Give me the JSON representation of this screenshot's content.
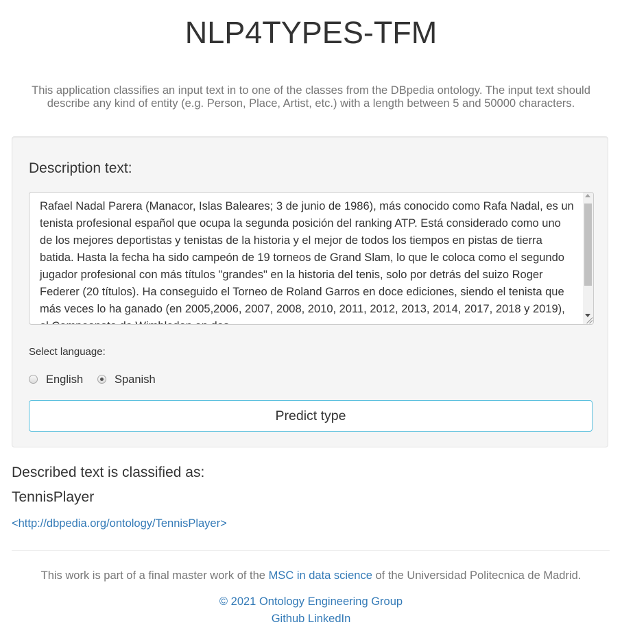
{
  "header": {
    "title": "NLP4TYPES-TFM",
    "intro": "This application classifies an input text in to one of the classes from the DBpedia ontology. The input text should describe any kind of entity (e.g. Person, Place, Artist, etc.) with a length between 5 and 50000 characters."
  },
  "form": {
    "description_label": "Description text:",
    "description_value": "Rafael Nadal Parera (Manacor, Islas Baleares; 3 de junio de 1986), más conocido como Rafa Nadal, es un tenista profesional español que ocupa la segunda posición del ranking ATP. Está considerado como uno de los mejores deportistas y tenistas de la historia y el mejor de todos los tiempos en pistas de tierra batida. Hasta la fecha ha sido campeón de 19 torneos de Grand Slam, lo que le coloca como el segundo jugador profesional con más títulos \"grandes\" en la historia del tenis, solo por detrás del suizo Roger Federer (20 títulos). Ha conseguido el Torneo de Roland Garros en doce ediciones, siendo el tenista que más veces lo ha ganado (en 2005,2006, 2007, 2008, 2010, 2011, 2012, 2013, 2014, 2017, 2018 y 2019), el Campeonato de Wimbledon en dos",
    "language_label": "Select language:",
    "languages": [
      {
        "label": "English",
        "checked": false
      },
      {
        "label": "Spanish",
        "checked": true
      }
    ],
    "submit_label": "Predict type"
  },
  "result": {
    "label": "Described text is classified as:",
    "type": "TennisPlayer",
    "uri": "<http://dbpedia.org/ontology/TennisPlayer>"
  },
  "footer": {
    "text_before": "This work is part of a final master work of the ",
    "link": "MSC in data science",
    "text_after": " of the Universidad Politecnica de Madrid.",
    "copyright": "© 2021 Ontology Engineering Group",
    "github": "Github",
    "linkedin": "LinkedIn"
  },
  "colors": {
    "link": "#337ab7",
    "button_border": "#5bc0de",
    "muted_text": "#777777"
  }
}
